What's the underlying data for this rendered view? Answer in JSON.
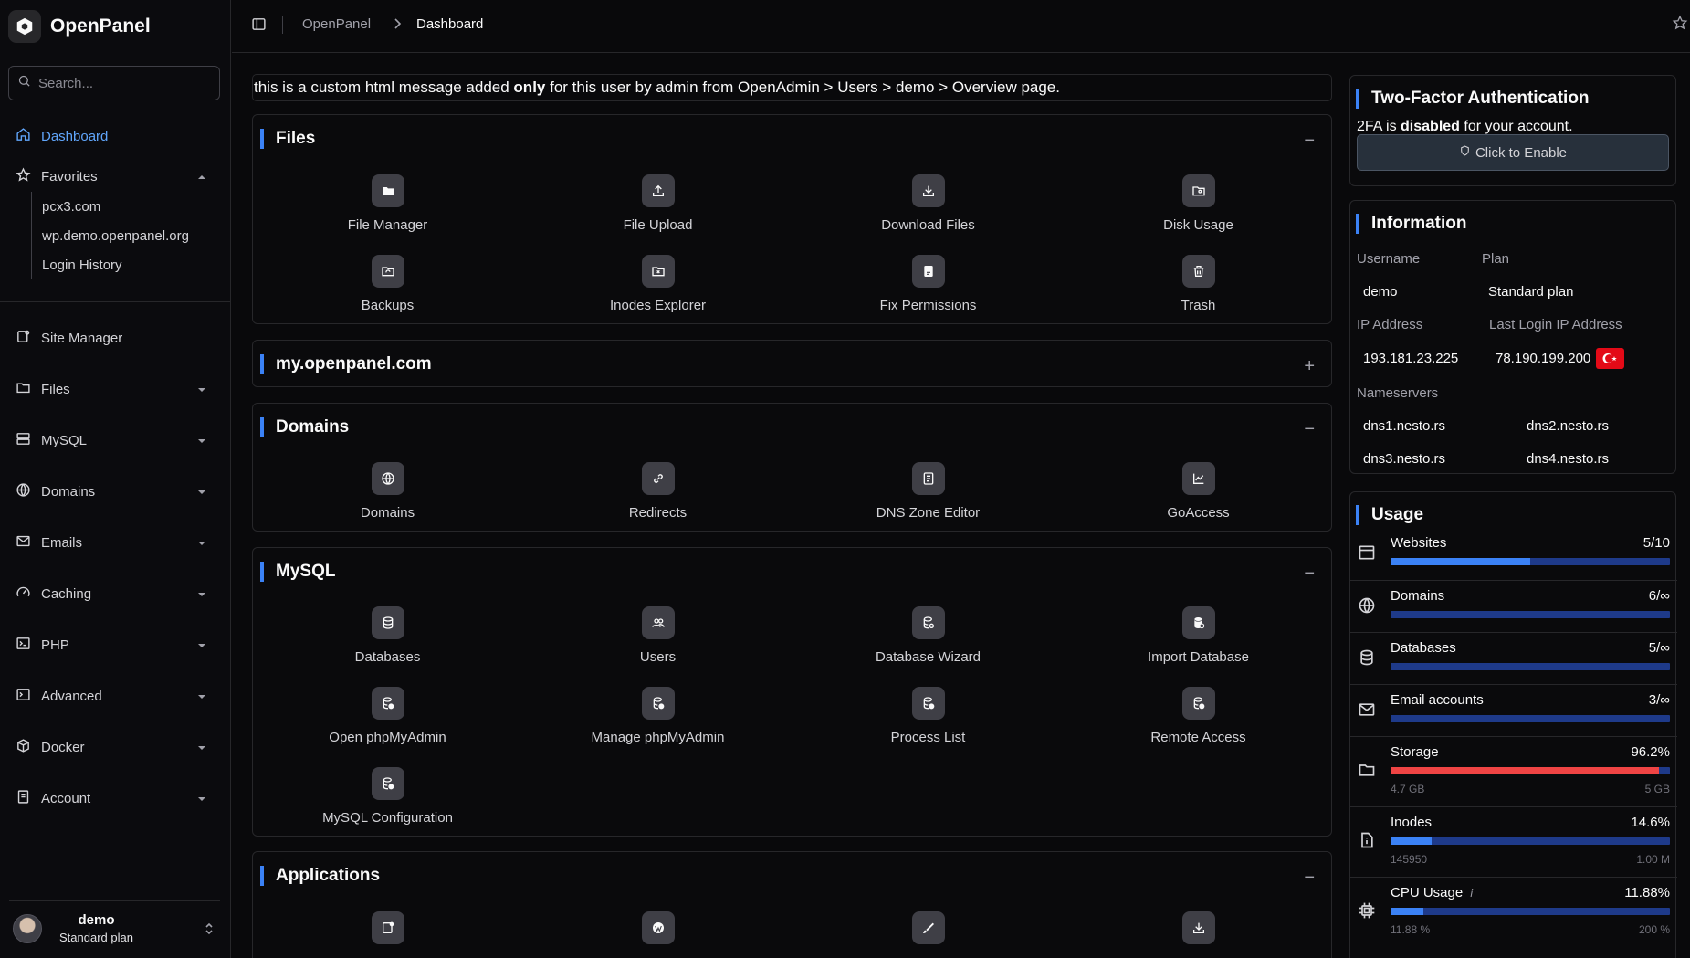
{
  "app": {
    "name": "OpenPanel"
  },
  "sidebar": {
    "search_placeholder": "Search...",
    "dashboard": "Dashboard",
    "favorites": "Favorites",
    "favorites_items": [
      "pcx3.com",
      "wp.demo.openpanel.org",
      "Login History"
    ],
    "items": [
      "Site Manager",
      "Files",
      "MySQL",
      "Domains",
      "Emails",
      "Caching",
      "PHP",
      "Advanced",
      "Docker",
      "Account"
    ],
    "user": {
      "name": "demo",
      "plan": "Standard plan"
    }
  },
  "breadcrumb": {
    "root": "OpenPanel",
    "current": "Dashboard"
  },
  "notice": {
    "prefix": "this is a custom html message added ",
    "bold": "only",
    "suffix": " for this user by admin from OpenAdmin > Users > demo > Overview page."
  },
  "panels": {
    "files": {
      "title": "Files",
      "ctrl": "−",
      "tiles": [
        "File Manager",
        "File Upload",
        "Download Files",
        "Disk Usage",
        "Backups",
        "Inodes Explorer",
        "Fix Permissions",
        "Trash"
      ]
    },
    "site": {
      "title": "my.openpanel.com",
      "ctrl": "+"
    },
    "domains": {
      "title": "Domains",
      "ctrl": "−",
      "tiles": [
        "Domains",
        "Redirects",
        "DNS Zone Editor",
        "GoAccess"
      ]
    },
    "mysql": {
      "title": "MySQL",
      "ctrl": "−",
      "tiles": [
        "Databases",
        "Users",
        "Database Wizard",
        "Import Database",
        "Open phpMyAdmin",
        "Manage phpMyAdmin",
        "Process List",
        "Remote Access",
        "MySQL Configuration"
      ]
    },
    "applications": {
      "title": "Applications",
      "ctrl": "−"
    }
  },
  "twofa": {
    "title": "Two-Factor Authentication",
    "text_prefix": "2FA is ",
    "text_bold": "disabled",
    "text_suffix": " for your account.",
    "button": "Click to Enable"
  },
  "information": {
    "title": "Information",
    "username_label": "Username",
    "username": "demo",
    "plan_label": "Plan",
    "plan": "Standard plan",
    "ip_label": "IP Address",
    "ip": "193.181.23.225",
    "last_ip_label": "Last Login IP Address",
    "last_ip": "78.190.199.200",
    "flag_color": "#e30a17",
    "ns_label": "Nameservers",
    "ns": [
      "dns1.nesto.rs",
      "dns2.nesto.rs",
      "dns3.nesto.rs",
      "dns4.nesto.rs"
    ]
  },
  "usage": {
    "title": "Usage",
    "rows": [
      {
        "label": "Websites",
        "value": "5/10",
        "fraction": 0.5
      },
      {
        "label": "Domains",
        "value": "6/∞",
        "fraction": 0
      },
      {
        "label": "Databases",
        "value": "5/∞",
        "fraction": 0
      },
      {
        "label": "Email accounts",
        "value": "3/∞",
        "fraction": 0
      },
      {
        "label": "Storage",
        "value": "96.2%",
        "fraction": 0.962,
        "min": "4.7 GB",
        "max": "5 GB"
      },
      {
        "label": "Inodes",
        "value": "14.6%",
        "fraction": 0.146,
        "min": "145950",
        "max": "1.00 M"
      },
      {
        "label": "CPU Usage",
        "value": "11.88%",
        "fraction": 0.1188,
        "min": "11.88 %",
        "max": "200 %"
      }
    ]
  },
  "colors": {
    "accent": "#3b82f6",
    "danger": "#ef4444",
    "active_nav": "#60a5fa"
  }
}
